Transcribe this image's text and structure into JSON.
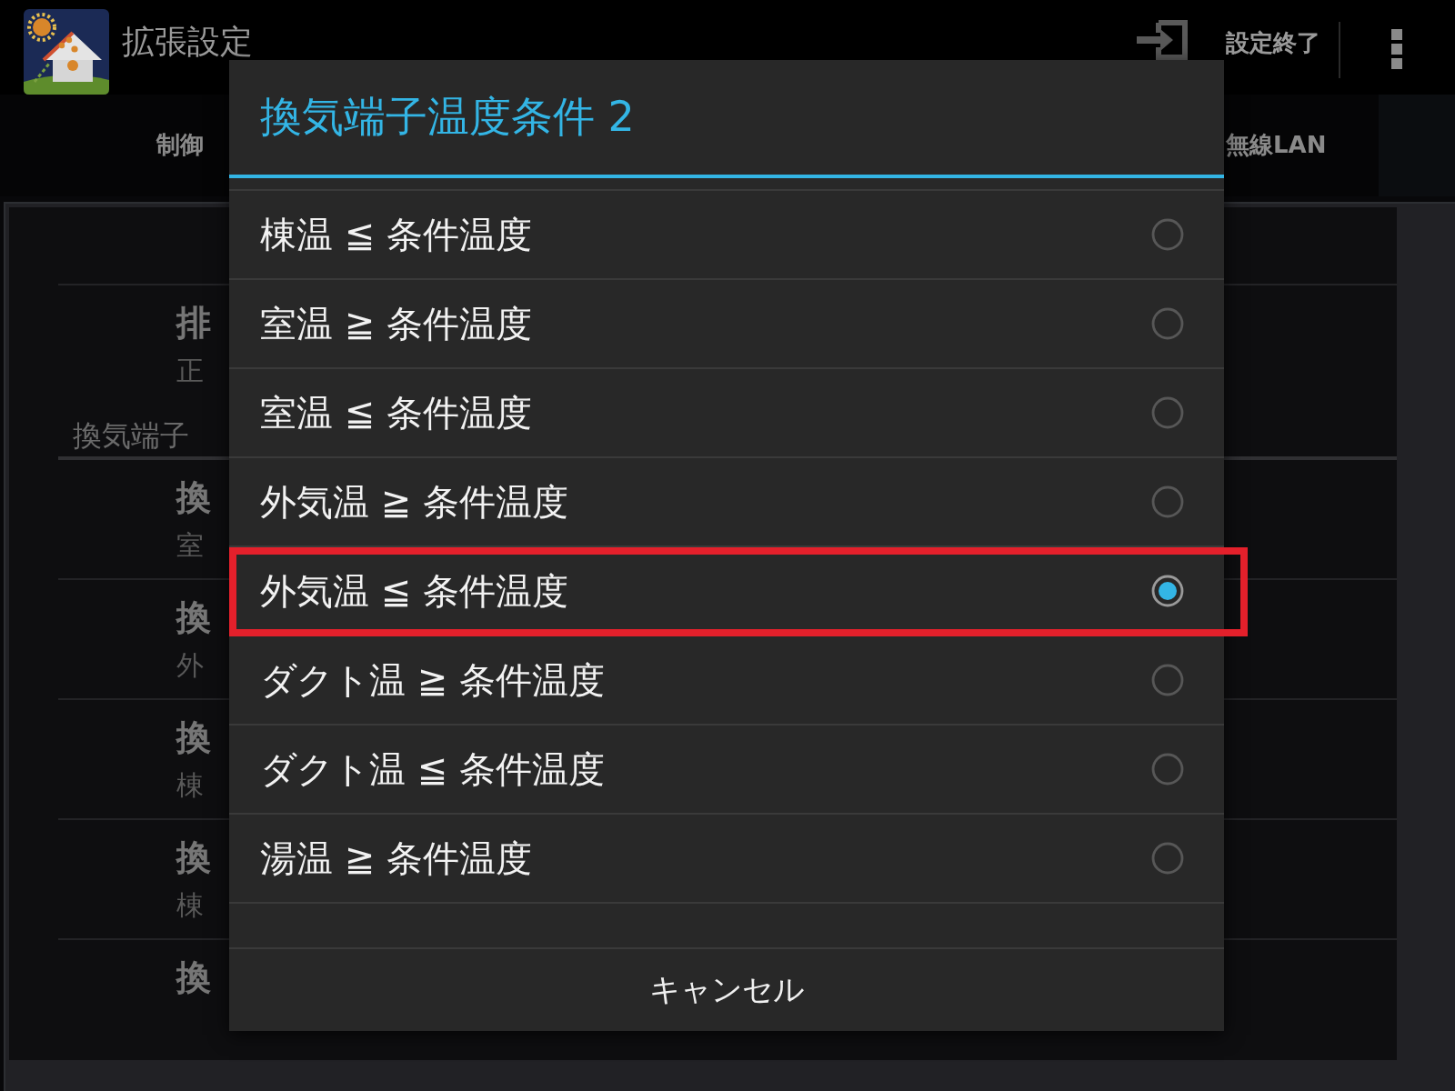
{
  "action_bar": {
    "title": "拡張設定",
    "action": {
      "label": "設定終了"
    }
  },
  "tabs": [
    {
      "label": "制御",
      "selected": false
    },
    {
      "label": "無線LAN",
      "selected": false
    }
  ],
  "settings_list": [
    {
      "kind": "item",
      "title": "排",
      "subtitle": "正"
    },
    {
      "kind": "header",
      "title": "換気端子"
    },
    {
      "kind": "item",
      "title": "換",
      "subtitle": "室"
    },
    {
      "kind": "item",
      "title": "換",
      "subtitle": "外"
    },
    {
      "kind": "item",
      "title": "換",
      "subtitle": "棟"
    },
    {
      "kind": "item",
      "title": "換",
      "subtitle": "棟"
    },
    {
      "kind": "item",
      "title": "換"
    }
  ],
  "dialog": {
    "title": "換気端子温度条件 2",
    "options": [
      {
        "label": "棟温 ≦ 条件温度",
        "selected": false,
        "highlighted": false
      },
      {
        "label": "室温 ≧ 条件温度",
        "selected": false,
        "highlighted": false
      },
      {
        "label": "室温 ≦ 条件温度",
        "selected": false,
        "highlighted": false
      },
      {
        "label": "外気温 ≧ 条件温度",
        "selected": false,
        "highlighted": false
      },
      {
        "label": "外気温 ≦ 条件温度",
        "selected": true,
        "highlighted": true
      },
      {
        "label": "ダクト温 ≧ 条件温度",
        "selected": false,
        "highlighted": false
      },
      {
        "label": "ダクト温 ≦ 条件温度",
        "selected": false,
        "highlighted": false
      },
      {
        "label": "湯温 ≧ 条件温度",
        "selected": false,
        "highlighted": false
      }
    ],
    "cancel_button": "キャンセル"
  }
}
